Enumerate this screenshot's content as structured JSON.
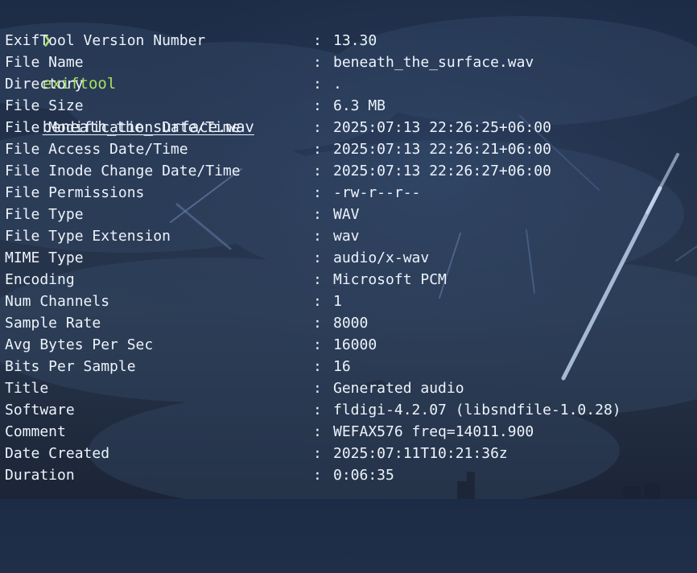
{
  "prompt": {
    "symbol": "❯",
    "command": "exiftool",
    "argument": "beneath_the_surface.wav"
  },
  "metadata": [
    {
      "key": "ExifTool Version Number",
      "sep": ":",
      "value": "13.30"
    },
    {
      "key": "File Name",
      "sep": ":",
      "value": "beneath_the_surface.wav"
    },
    {
      "key": "Directory",
      "sep": ":",
      "value": "."
    },
    {
      "key": "File Size",
      "sep": ":",
      "value": "6.3 MB"
    },
    {
      "key": "File Modification Date/Time",
      "sep": ":",
      "value": "2025:07:13 22:26:25+06:00"
    },
    {
      "key": "File Access Date/Time",
      "sep": ":",
      "value": "2025:07:13 22:26:21+06:00"
    },
    {
      "key": "File Inode Change Date/Time",
      "sep": ":",
      "value": "2025:07:13 22:26:27+06:00"
    },
    {
      "key": "File Permissions",
      "sep": ":",
      "value": "-rw-r--r--"
    },
    {
      "key": "File Type",
      "sep": ":",
      "value": "WAV"
    },
    {
      "key": "File Type Extension",
      "sep": ":",
      "value": "wav"
    },
    {
      "key": "MIME Type",
      "sep": ":",
      "value": "audio/x-wav"
    },
    {
      "key": "Encoding",
      "sep": ":",
      "value": "Microsoft PCM"
    },
    {
      "key": "Num Channels",
      "sep": ":",
      "value": "1"
    },
    {
      "key": "Sample Rate",
      "sep": ":",
      "value": "8000"
    },
    {
      "key": "Avg Bytes Per Sec",
      "sep": ":",
      "value": "16000"
    },
    {
      "key": "Bits Per Sample",
      "sep": ":",
      "value": "16"
    },
    {
      "key": "Title",
      "sep": ":",
      "value": "Generated audio"
    },
    {
      "key": "Software",
      "sep": ":",
      "value": "fldigi-4.2.07 (libsndfile-1.0.28)"
    },
    {
      "key": "Comment",
      "sep": ":",
      "value": "WEFAX576 freq=14011.900"
    },
    {
      "key": "Date Created",
      "sep": ":",
      "value": "2025:07:11T10:21:36z"
    },
    {
      "key": "Duration",
      "sep": ":",
      "value": "0:06:35"
    }
  ]
}
